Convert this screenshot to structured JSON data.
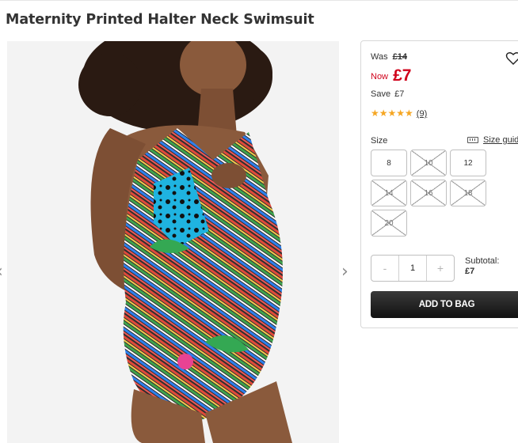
{
  "product": {
    "title": "Maternity Printed Halter Neck Swimsuit",
    "image_alt": "Maternity Printed Halter Neck Swimsuit"
  },
  "gallery": {
    "prev_icon": "chevron-left-icon",
    "next_icon": "chevron-right-icon",
    "prev_glyph": "‹",
    "next_glyph": "›"
  },
  "pricing": {
    "was_label": "Was",
    "was_price": "£14",
    "now_label": "Now",
    "now_price": "£7",
    "save_label": "Save",
    "save_amount": "£7",
    "accent_color": "#d0021b"
  },
  "rating": {
    "stars": 5,
    "stars_glyphs": "★★★★★",
    "count": "(9)",
    "star_color": "#f5a623"
  },
  "size": {
    "label": "Size",
    "guide_label": "Size guide",
    "options": [
      {
        "label": "8",
        "available": true
      },
      {
        "label": "10",
        "available": false
      },
      {
        "label": "12",
        "available": true
      },
      {
        "label": "14",
        "available": false
      },
      {
        "label": "16",
        "available": false
      },
      {
        "label": "18",
        "available": false
      },
      {
        "label": "20",
        "available": false
      }
    ]
  },
  "quantity": {
    "minus": "-",
    "value": "1",
    "plus": "+"
  },
  "subtotal": {
    "label": "Subtotal:",
    "value": "£7"
  },
  "actions": {
    "add_to_bag": "ADD TO BAG",
    "wishlist_icon": "heart-icon"
  }
}
